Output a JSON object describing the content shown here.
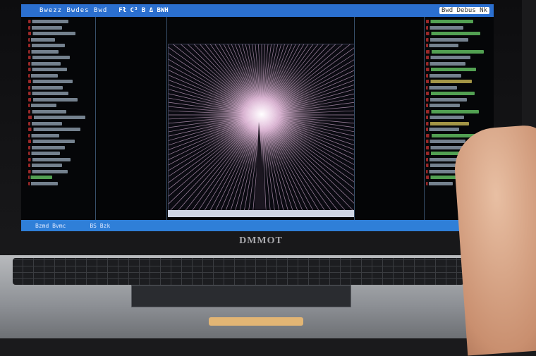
{
  "screen": {
    "titlebar": {
      "left_text": "Bwezz Bwdes Bwd",
      "mid_text": "Fł C³ B Δ BWH",
      "right_text": "Bwd Debus Nk"
    },
    "statusbar": {
      "left_text": "Bzmd Bvmc",
      "right_text": "BS Bzk"
    },
    "viewer": {
      "description_icon": "light-burst-icon"
    }
  },
  "laptop": {
    "brand": "DMMOT"
  }
}
